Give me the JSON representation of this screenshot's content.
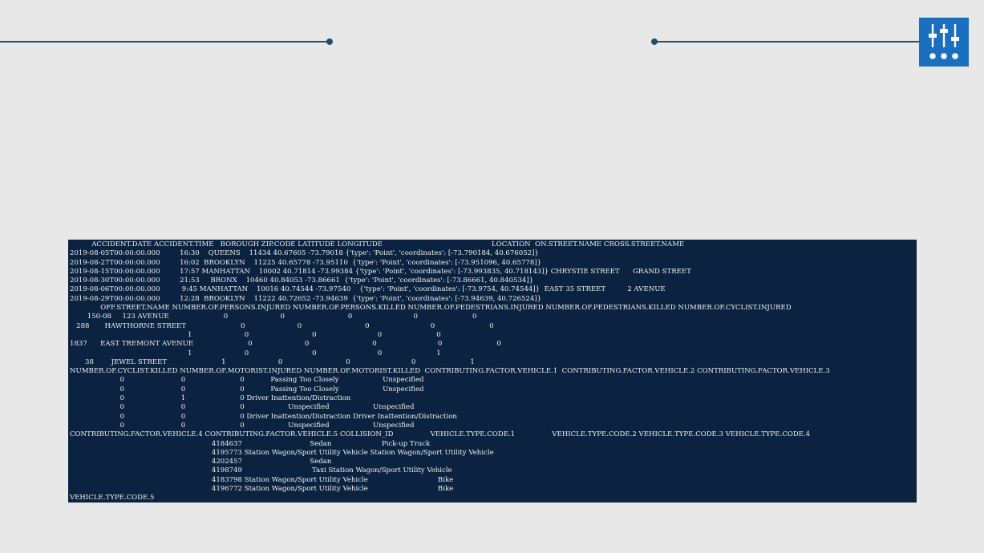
{
  "header_icon": "sliders-icon",
  "colors": {
    "accent": "#1f4e6a",
    "logo_bg": "#1a6fbf",
    "console_bg": "#0b2340",
    "console_text": "#f2f2f2"
  },
  "output": {
    "blocks": [
      {
        "columns": [
          "ACCIDENT.DATE",
          "ACCIDENT.TIME",
          "BOROUGH",
          "ZIP.CODE",
          "LATITUDE",
          "LONGITUDE",
          "LOCATION",
          "ON.STREET.NAME",
          "CROSS.STREET.NAME"
        ],
        "rows": [
          [
            "2019-08-05T00:00:00.000",
            "16:30",
            "QUEENS",
            "11434",
            "40.67605",
            "-73.79018",
            "{'type': 'Point', 'coordinates': [-73.790184, 40.676052]}",
            "",
            ""
          ],
          [
            "2019-08-27T00:00:00.000",
            "16:02",
            "BROOKLYN",
            "11225",
            "40.65778",
            "-73.95110",
            "{'type': 'Point', 'coordinates': [-73.951096, 40.65778]}",
            "",
            ""
          ],
          [
            "2019-08-15T00:00:00.000",
            "17:57",
            "MANHATTAN",
            "10002",
            "40.71814",
            "-73.99384",
            "{'type': 'Point', 'coordinates': [-73.993835, 40.718143]}",
            "CHRYSTIE STREET",
            "GRAND STREET"
          ],
          [
            "2019-08-30T00:00:00.000",
            "21:53",
            "BRONX",
            "10460",
            "40.84053",
            "-73.86661",
            "{'type': 'Point', 'coordinates': [-73.86661, 40.840534]}",
            "",
            ""
          ],
          [
            "2019-08-06T00:00:00.000",
            "9:45",
            "MANHATTAN",
            "10016",
            "40.74544",
            "-73.97540",
            "{'type': 'Point', 'coordinates': [-73.9754, 40.74544]}",
            "EAST 35 STREET",
            "2 AVENUE"
          ],
          [
            "2019-08-29T00:00:00.000",
            "12:28",
            "BROOKLYN",
            "11222",
            "40.72652",
            "-73.94639",
            "{'type': 'Point', 'coordinates': [-73.94639, 40.726524]}",
            "",
            ""
          ]
        ]
      },
      {
        "columns": [
          "OFF.STREET.NAME",
          "NUMBER.OF.PERSONS.INJURED",
          "NUMBER.OF.PERSONS.KILLED",
          "NUMBER.OF.PEDESTRIANS.INJURED",
          "NUMBER.OF.PEDESTRIANS.KILLED",
          "NUMBER.OF.CYCLIST.INJURED"
        ],
        "rows": [
          [
            "150-08     123 AVENUE",
            "0",
            "0",
            "0",
            "0",
            "0"
          ],
          [
            "288       HAWTHORNE STREET",
            "0",
            "0",
            "0",
            "0",
            "0"
          ],
          [
            "",
            "1",
            "0",
            "0",
            "0",
            "0"
          ],
          [
            "1837      EAST TREMONT AVENUE",
            "0",
            "0",
            "0",
            "0",
            "0"
          ],
          [
            "",
            "1",
            "0",
            "0",
            "0",
            "1"
          ],
          [
            "38        JEWEL STREET",
            "1",
            "0",
            "0",
            "0",
            "1"
          ]
        ]
      },
      {
        "columns": [
          "NUMBER.OF.CYCLIST.KILLED",
          "NUMBER.OF.MOTORIST.INJURED",
          "NUMBER.OF.MOTORIST.KILLED",
          "CONTRIBUTING.FACTOR.VEHICLE.1",
          "CONTRIBUTING.FACTOR.VEHICLE.2",
          "CONTRIBUTING.FACTOR.VEHICLE.3"
        ],
        "rows": [
          [
            "0",
            "0",
            "0",
            "Passing Too Closely",
            "Unspecified",
            ""
          ],
          [
            "0",
            "0",
            "0",
            "Passing Too Closely",
            "Unspecified",
            ""
          ],
          [
            "0",
            "1",
            "0",
            "Driver Inattention/Distraction",
            "",
            ""
          ],
          [
            "0",
            "0",
            "0",
            "Unspecified",
            "Unspecified",
            ""
          ],
          [
            "0",
            "0",
            "0",
            "Driver Inattention/Distraction",
            "Driver Inattention/Distraction",
            ""
          ],
          [
            "0",
            "0",
            "0",
            "Unspecified",
            "Unspecified",
            ""
          ]
        ]
      },
      {
        "columns": [
          "CONTRIBUTING.FACTOR.VEHICLE.4",
          "CONTRIBUTING.FACTOR.VEHICLE.5",
          "COLLISION_ID",
          "VEHICLE.TYPE.CODE.1",
          "VEHICLE.TYPE.CODE.2",
          "VEHICLE.TYPE.CODE.3",
          "VEHICLE.TYPE.CODE.4"
        ],
        "rows": [
          [
            "",
            "",
            "4184637",
            "Sedan",
            "Pick-up Truck",
            "",
            ""
          ],
          [
            "",
            "",
            "4195773",
            "Station Wagon/Sport Utility Vehicle",
            "Station Wagon/Sport Utility Vehicle",
            "",
            ""
          ],
          [
            "",
            "",
            "4202457",
            "Sedan",
            "",
            "",
            ""
          ],
          [
            "",
            "",
            "4198749",
            "Taxi",
            "Station Wagon/Sport Utility Vehicle",
            "",
            ""
          ],
          [
            "",
            "",
            "4183798",
            "Station Wagon/Sport Utility Vehicle",
            "Bike",
            "",
            ""
          ],
          [
            "",
            "",
            "4196772",
            "Station Wagon/Sport Utility Vehicle",
            "Bike",
            "",
            ""
          ]
        ]
      },
      {
        "columns": [
          "VEHICLE.TYPE.CODE.5"
        ],
        "rows": []
      }
    ]
  }
}
